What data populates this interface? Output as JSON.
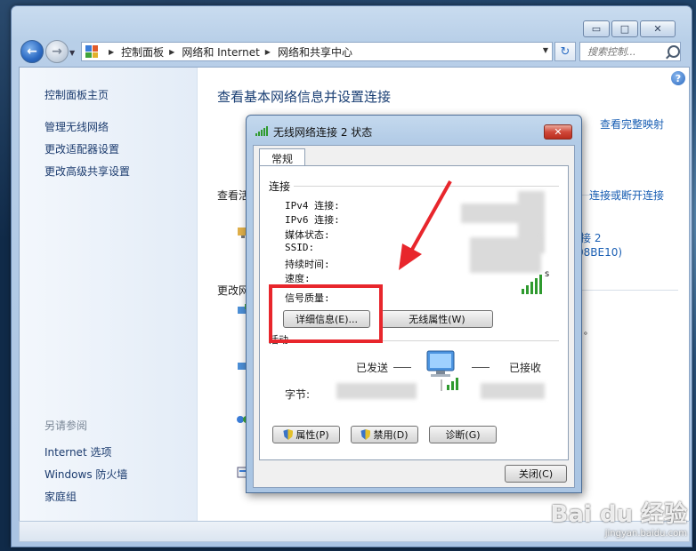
{
  "window": {
    "caption_buttons": {
      "min": "▭",
      "max": "□",
      "close": "✕"
    }
  },
  "nav": {
    "back_icon": "arrow-left-icon",
    "breadcrumbs": [
      "控制面板",
      "网络和 Internet",
      "网络和共享中心"
    ],
    "search_placeholder": "搜索控制...",
    "refresh_icon": "↻"
  },
  "left_pane": {
    "home": "控制面板主页",
    "links": [
      "管理无线网络",
      "更改适配器设置",
      "更改高级共享设置"
    ],
    "see_also_title": "另请参阅",
    "see_also": [
      "Internet 选项",
      "Windows 防火墙",
      "家庭组"
    ]
  },
  "main": {
    "title": "查看基本网络信息并设置连接",
    "full_map_link": "查看完整映射",
    "active_label": "查看活",
    "connect_link": "连接或断开连接",
    "conn_name_partial": "接 2",
    "conn_id_partial": "08BE10)",
    "change_label": "更改网",
    "s_partial": "s",
    "dot_partial": "。"
  },
  "dialog": {
    "title": "无线网络连接 2 状态",
    "close": "✕",
    "tab": "常规",
    "connection_group": "连接",
    "rows": [
      "IPv4 连接:",
      "IPv6 连接:",
      "媒体状态:",
      "SSID:",
      "持续时间:",
      "速度:"
    ],
    "signal_quality": "信号质量:",
    "details_button": "详细信息(E)...",
    "wireless_props_button": "无线属性(W)",
    "activity_group": "活动",
    "sent_label": "已发送",
    "received_label": "已接收",
    "bytes_label": "字节:",
    "properties_button": "属性(P)",
    "disable_button": "禁用(D)",
    "diagnose_button": "诊断(G)",
    "close_button": "关闭(C)"
  },
  "watermark": {
    "main": "Bai du 经验",
    "sub": "jingyan.baidu.com"
  },
  "colors": {
    "accent": "#1a5fb4",
    "highlight": "#e8262c",
    "signal": "#2f9a2f"
  }
}
